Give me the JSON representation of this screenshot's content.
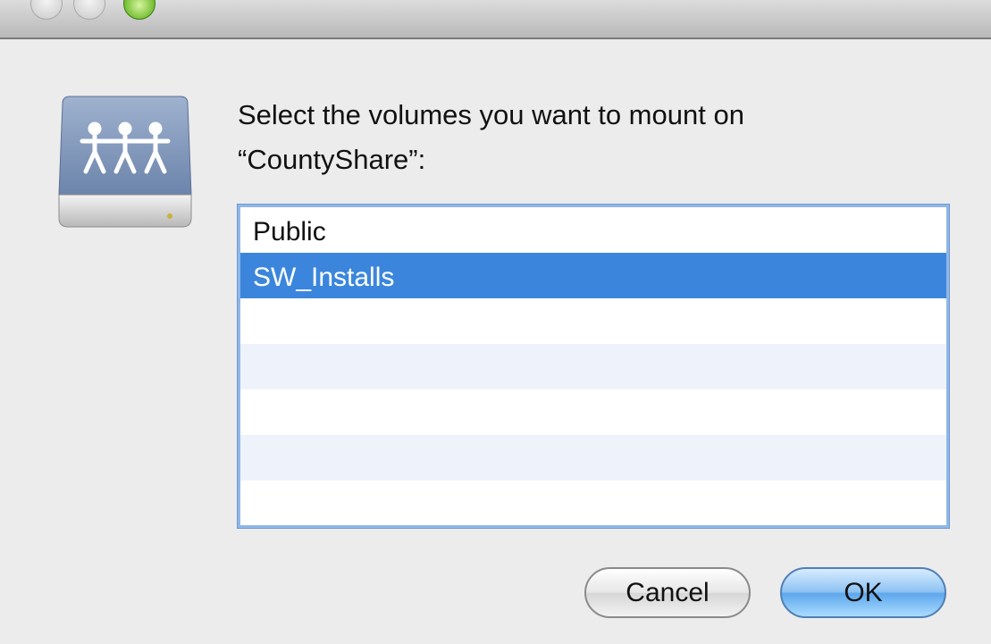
{
  "window": {
    "controls": [
      "close",
      "minimize",
      "zoom"
    ]
  },
  "dialog": {
    "icon": "shared-network-drive-icon",
    "prompt_line1": "Select the volumes you want to mount on",
    "prompt_line2": "“CountyShare”:",
    "volumes": [
      {
        "label": "Public",
        "selected": false
      },
      {
        "label": "SW_Installs",
        "selected": true
      },
      {
        "label": "",
        "selected": false
      },
      {
        "label": "",
        "selected": false
      },
      {
        "label": "",
        "selected": false
      },
      {
        "label": "",
        "selected": false
      },
      {
        "label": "",
        "selected": false
      }
    ],
    "cancel_label": "Cancel",
    "ok_label": "OK"
  },
  "colors": {
    "selection": "#3b86dc",
    "alternate_row": "#eef3fb",
    "focus_ring": "#8fb7e8"
  }
}
